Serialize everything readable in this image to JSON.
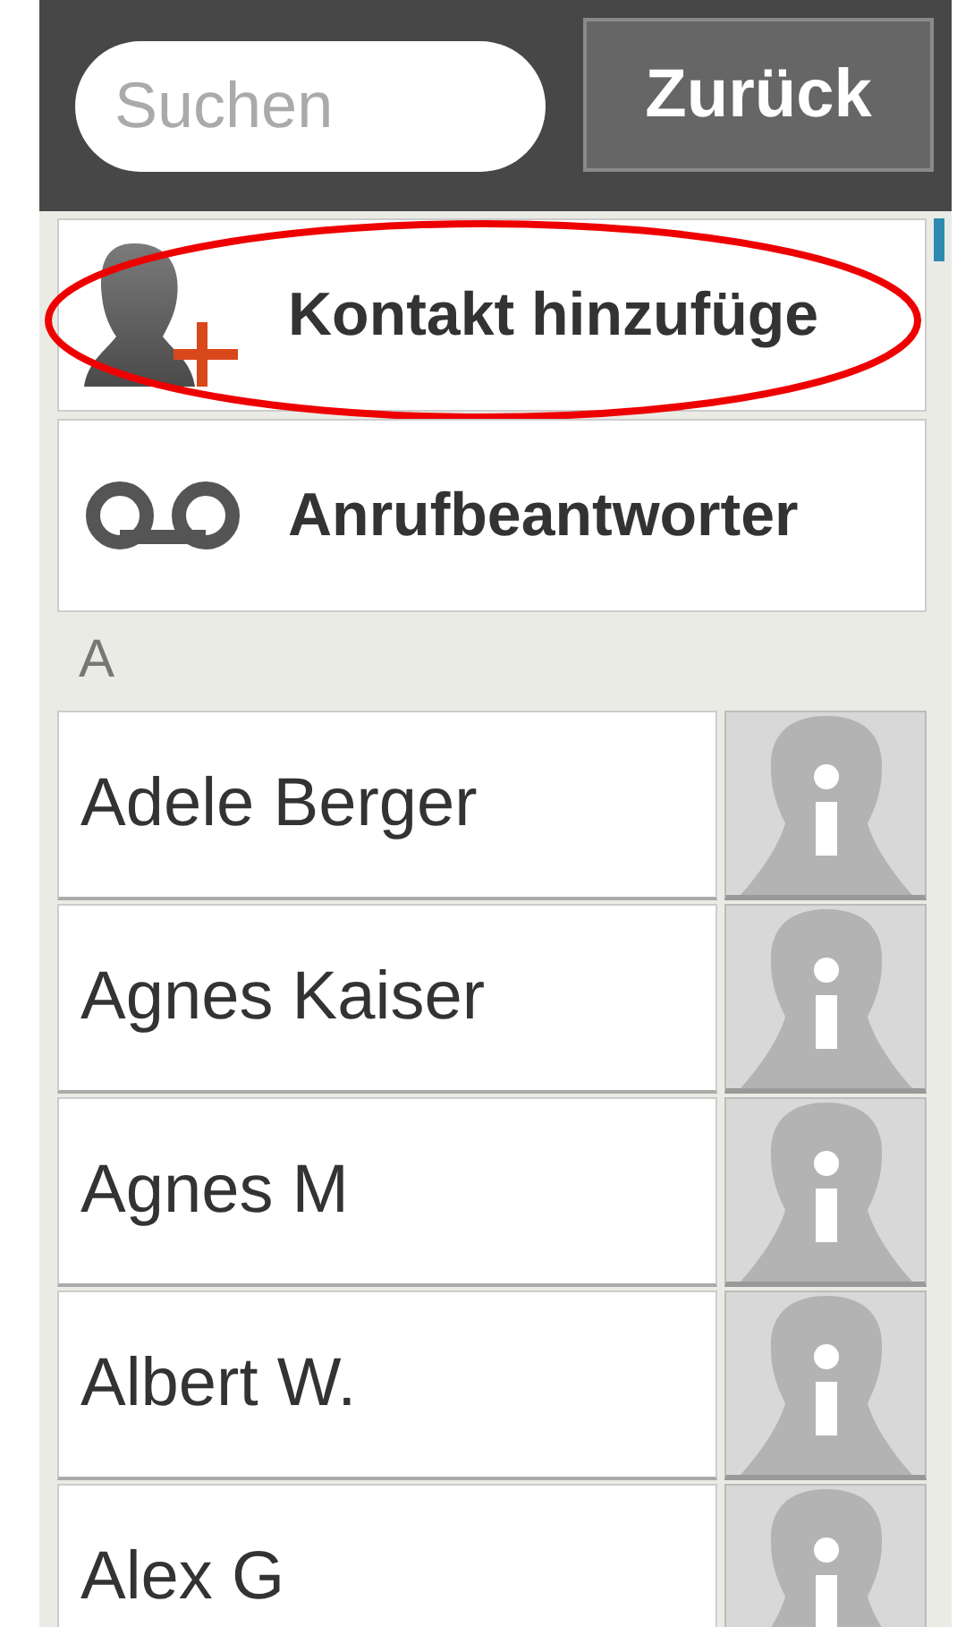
{
  "search": {
    "placeholder": "Suchen"
  },
  "back_button": {
    "label": "Zurück"
  },
  "actions": [
    {
      "kind": "add_contact",
      "label": "Kontakt hinzufüge",
      "highlighted": true
    },
    {
      "kind": "voicemail",
      "label": "Anrufbeantworter",
      "highlighted": false
    }
  ],
  "sections": [
    {
      "letter": "A",
      "contacts": [
        {
          "name": "Adele Berger"
        },
        {
          "name": "Agnes Kaiser"
        },
        {
          "name": "Agnes M"
        },
        {
          "name": "Albert W."
        },
        {
          "name": "Alex G"
        }
      ]
    }
  ]
}
